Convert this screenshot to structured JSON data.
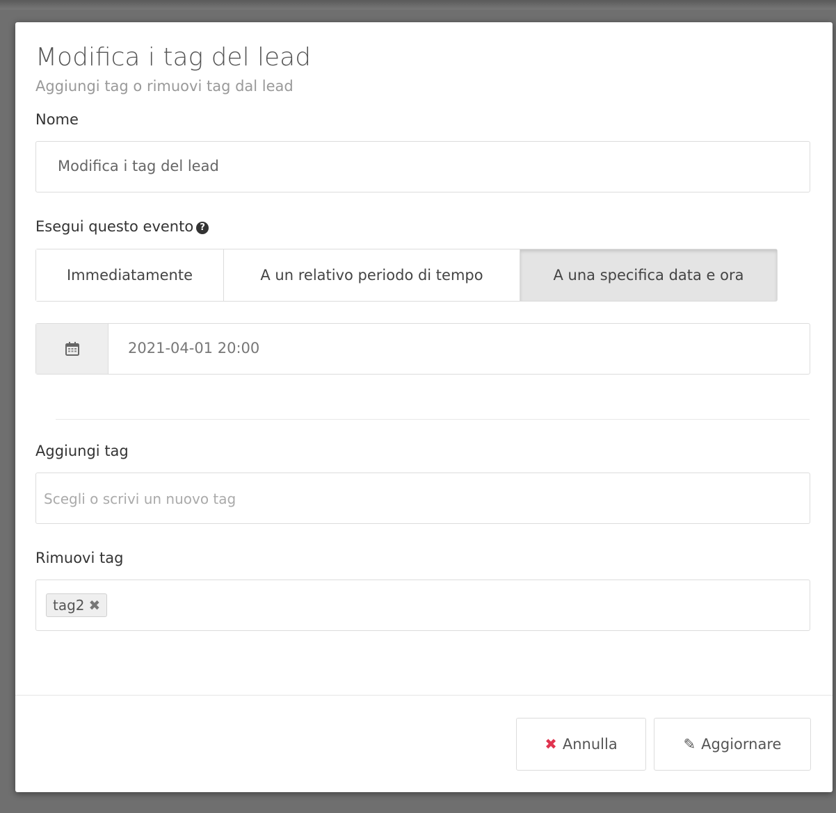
{
  "modal": {
    "title": "Modifica i tag del lead",
    "subtitle": "Aggiungi tag o rimuovi tag dal lead"
  },
  "name_field": {
    "label": "Nome",
    "value": "Modifica i tag del lead"
  },
  "trigger": {
    "label": "Esegui questo evento",
    "help_icon": "question-circle-icon",
    "options": [
      {
        "label": "Immediatamente",
        "active": false
      },
      {
        "label": "A un relativo periodo di tempo",
        "active": false
      },
      {
        "label": "A una specifica data e ora",
        "active": true
      }
    ]
  },
  "datetime": {
    "icon": "calendar-icon",
    "value": "2021-04-01 20:00"
  },
  "add_tags": {
    "label": "Aggiungi tag",
    "placeholder": "Scegli o scrivi un nuovo tag"
  },
  "remove_tags": {
    "label": "Rimuovi tag",
    "tags": [
      {
        "label": "tag2",
        "remove_symbol": "✖"
      }
    ]
  },
  "footer": {
    "cancel_label": "Annulla",
    "cancel_icon": "close-icon",
    "cancel_icon_color": "#e0344f",
    "update_label": "Aggiornare",
    "update_icon": "pencil-icon"
  }
}
